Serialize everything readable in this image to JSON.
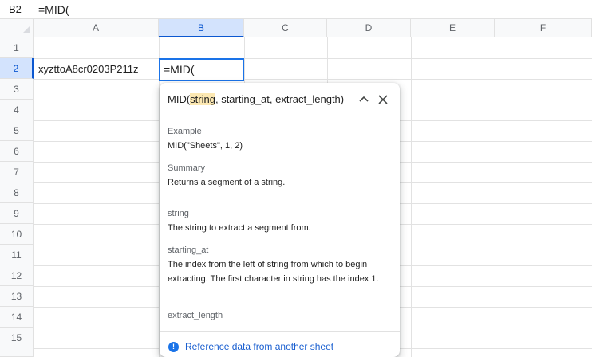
{
  "formula_bar": {
    "name_box": "B2",
    "formula": "=MID("
  },
  "columns": [
    "A",
    "B",
    "C",
    "D",
    "E",
    "F"
  ],
  "rows": [
    "1",
    "2",
    "3",
    "4",
    "5",
    "6",
    "7",
    "8",
    "9",
    "10",
    "11",
    "12",
    "13",
    "14",
    "15"
  ],
  "active": {
    "column": "B",
    "row": "2"
  },
  "cells": {
    "A2": "xyzttoA8cr0203P211z",
    "B2": "=MID("
  },
  "help_popup": {
    "function_name": "MID(",
    "highlighted_arg": "string",
    "remaining_args": ", starting_at, extract_length)",
    "example_label": "Example",
    "example_value": "MID(\"Sheets\", 1, 2)",
    "summary_label": "Summary",
    "summary_value": "Returns a segment of a string.",
    "args": [
      {
        "name": "string",
        "description": "The string to extract a segment from."
      },
      {
        "name": "starting_at",
        "description": "The index from the left of string from which to begin extracting. The first character in string has the index 1."
      },
      {
        "name": "extract_length",
        "description": ""
      }
    ],
    "footer_link": "Reference data from another sheet"
  },
  "colors": {
    "accent": "#1a73e8",
    "header_bg": "#f8f9fa",
    "active_header_bg": "#d3e3fd",
    "arg_highlight": "#fce8b2"
  }
}
